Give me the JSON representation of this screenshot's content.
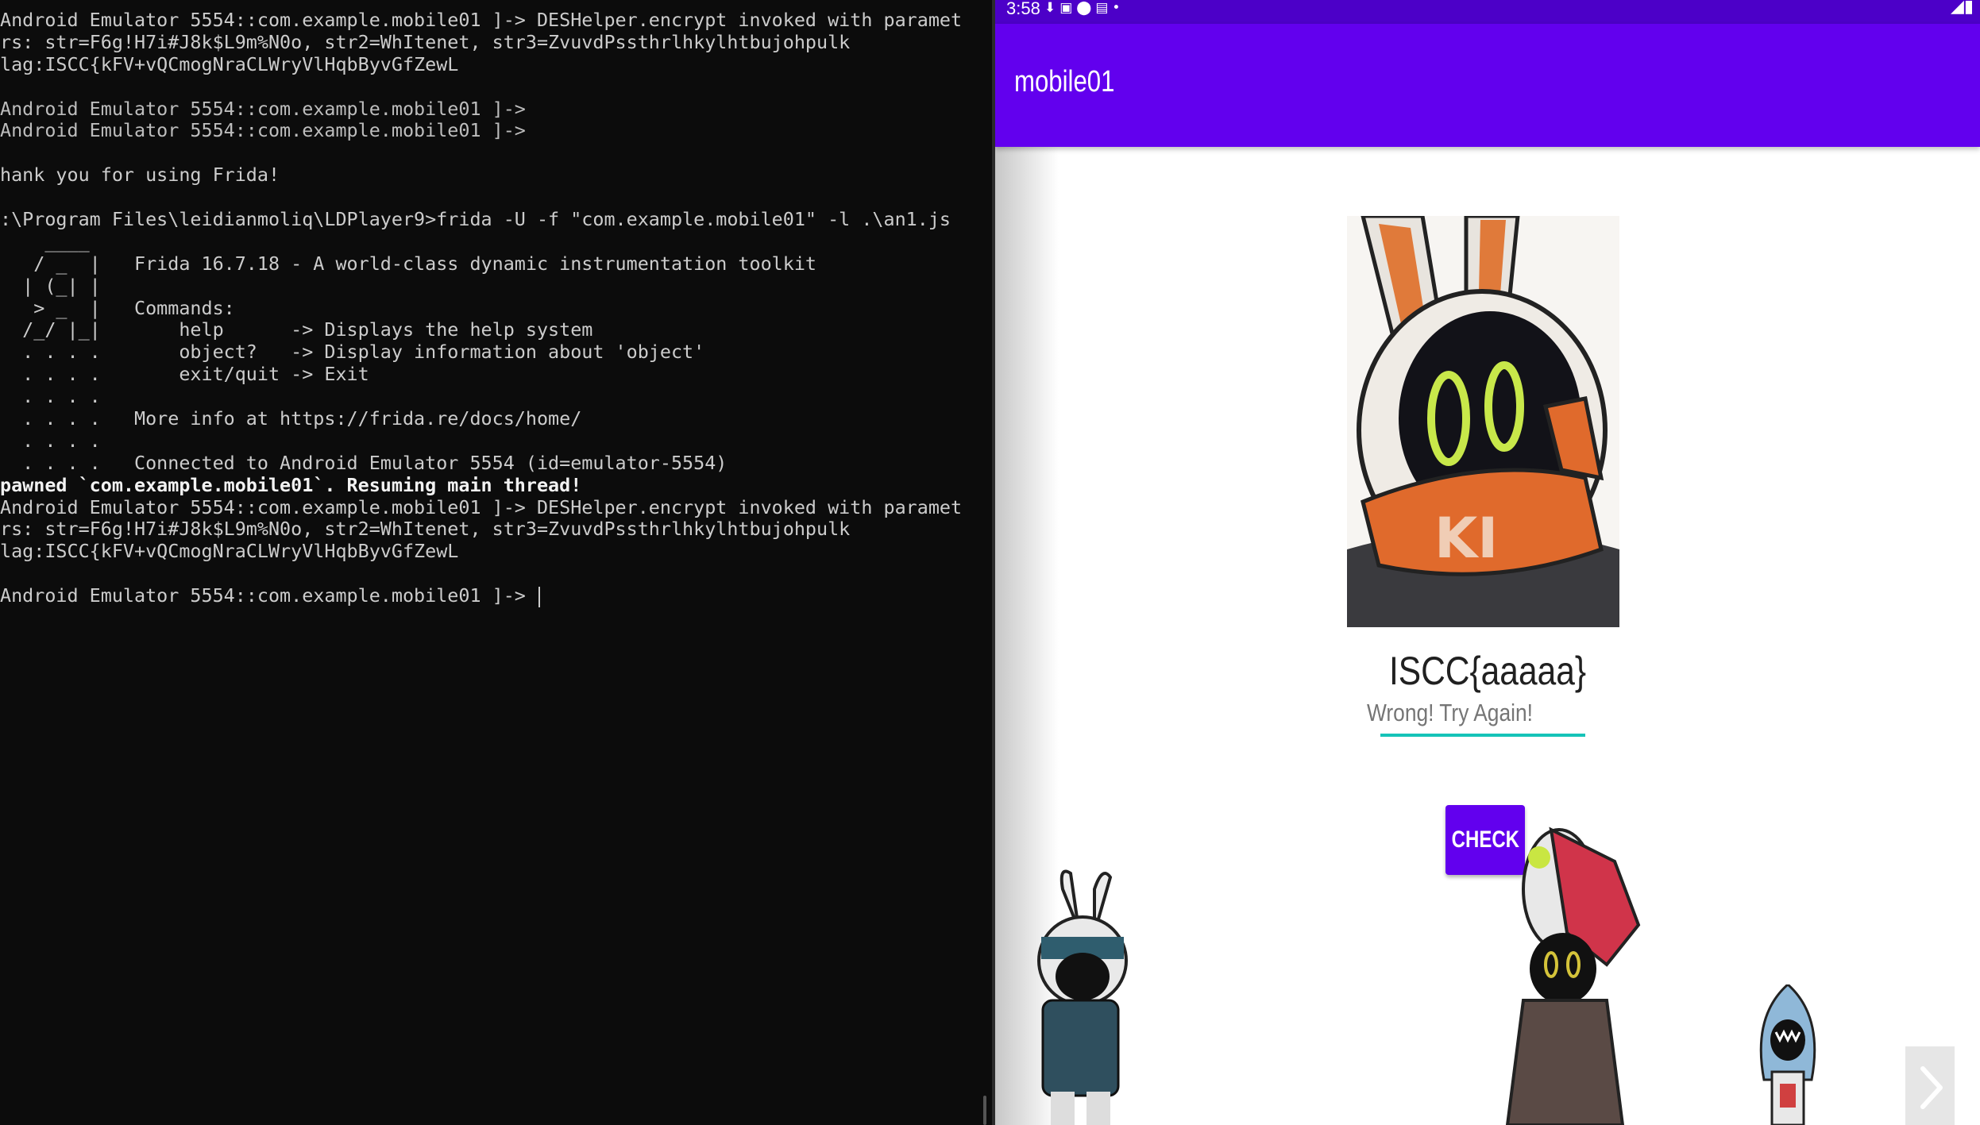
{
  "terminal": {
    "lines": [
      "Android Emulator 5554::com.example.mobile01 ]-> DESHelper.encrypt invoked with paramet",
      "rs: str=F6g!H7i#J8k$L9m%N0o, str2=WhItenet, str3=ZvuvdPssthrlhkylhtbujohpulk",
      "lag:ISCC{kFV+vQCmogNraCLWryVlHqbByvGfZewL",
      "",
      "Android Emulator 5554::com.example.mobile01 ]->",
      "Android Emulator 5554::com.example.mobile01 ]->",
      "",
      "hank you for using Frida!",
      "",
      ":\\Program Files\\leidianmoliq\\LDPlayer9>frida -U -f \"com.example.mobile01\" -l .\\an1.js",
      "    ____",
      "   / _  |   Frida 16.7.18 - A world-class dynamic instrumentation toolkit",
      "  | (_| |",
      "   > _  |   Commands:",
      "  /_/ |_|       help      -> Displays the help system",
      "  . . . .       object?   -> Display information about 'object'",
      "  . . . .       exit/quit -> Exit",
      "  . . . .",
      "  . . . .   More info at https://frida.re/docs/home/",
      "  . . . .",
      "  . . . .   Connected to Android Emulator 5554 (id=emulator-5554)",
      "pawned `com.example.mobile01`. Resuming main thread!",
      "Android Emulator 5554::com.example.mobile01 ]-> DESHelper.encrypt invoked with paramet",
      "rs: str=F6g!H7i#J8k$L9m%N0o, str2=WhItenet, str3=ZvuvdPssthrlhkylhtbujohpulk",
      "lag:ISCC{kFV+vQCmogNraCLWryVlHqbByvGfZewL",
      "",
      "Android Emulator 5554::com.example.mobile01 ]-> "
    ]
  },
  "phone": {
    "status_time": "3:58",
    "app_title": "mobile01",
    "input_value": "ISCC{aaaaa}",
    "result_text": "Wrong! Try Again!",
    "button_label": "CHECK"
  },
  "colors": {
    "primary": "#6200ee",
    "status_bar": "#4c00c8",
    "accent": "#16c3b8",
    "terminal_bg": "#0c0c0c"
  }
}
